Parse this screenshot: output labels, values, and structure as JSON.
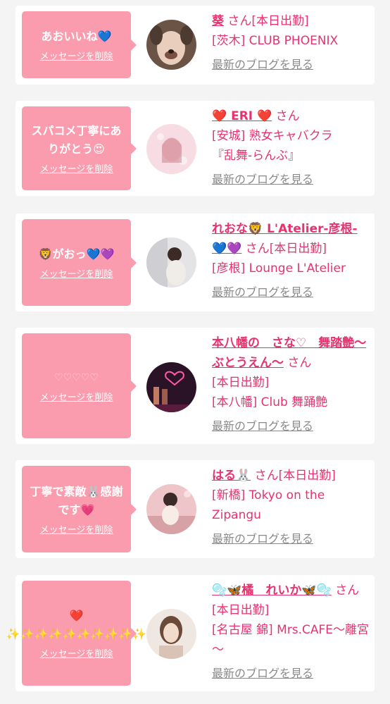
{
  "common": {
    "delete_label": "メッセージを削除",
    "blog_label": "最新のブログを見る",
    "san": "さん",
    "today": "[本日出勤]"
  },
  "colors": {
    "page_bg": "#f4f4f4",
    "bubble_bg": "#fb9cae",
    "accent_text": "#e8326e",
    "muted_text": "#8a8a8a"
  },
  "cards": [
    {
      "message": "あおいいね💙",
      "name": "葵",
      "name_suffix": "さん[本日出勤]",
      "shop_lines": [
        "[茨木] CLUB PHOENIX"
      ]
    },
    {
      "message": "スパコメ丁寧にありがとう😍",
      "name": "❤️ ERI ❤️",
      "name_suffix": "さん",
      "shop_lines": [
        "[安城] 熟女キャバクラ",
        "『乱舞-らんぶ』"
      ]
    },
    {
      "message": "🦁がおっ💙💜",
      "name": "れおな🦁 L'Atelier-彦根-💙💜",
      "name_suffix": "さん[本日出勤]",
      "shop_lines": [
        "[彦根] Lounge L'Atelier"
      ]
    },
    {
      "message": "♡♡♡♡♡",
      "name": "本八幡の　さな♡　舞踏艶～ぶとうえん～",
      "name_suffix": "さん",
      "shop_lines": [
        "[本日出勤]",
        "[本八幡] Club 舞踊艶"
      ]
    },
    {
      "message": "丁寧で素敵🐰感謝です💗",
      "name": "はる🐰",
      "name_suffix": "さん[本日出勤]",
      "shop_lines": [
        "[新橋] Tokyo on the Zipangu"
      ]
    },
    {
      "message": "❤️\n✨✨✨✨✨✨✨✨✨✨",
      "name": "🫧🦋橘　れいか🦋🫧",
      "name_suffix": "さん[本日出勤]",
      "shop_lines": [
        "[名古屋 錦] Mrs.CAFE～離宮～"
      ]
    }
  ]
}
